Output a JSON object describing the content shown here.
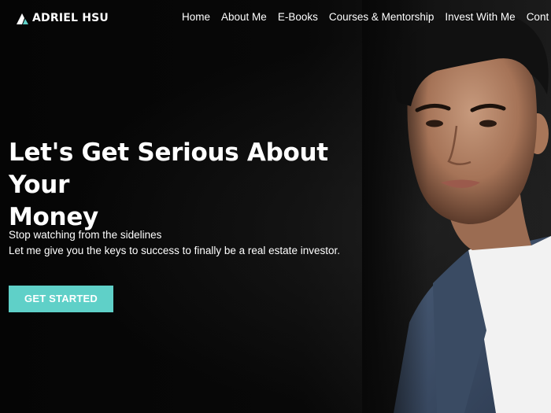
{
  "brand": {
    "name": "ADRIEL HSU",
    "logo_icon": "mountain-logo-icon",
    "accent_color": "#5fd0c8"
  },
  "nav": {
    "items": [
      {
        "label": "Home"
      },
      {
        "label": "About Me"
      },
      {
        "label": "E-Books"
      },
      {
        "label": "Courses & Mentorship"
      },
      {
        "label": "Invest With Me"
      },
      {
        "label": "Cont"
      }
    ]
  },
  "hero": {
    "title_line1": "Let's Get Serious About Your",
    "title_line2": "Money",
    "subtitle_line1": "Stop watching from the sidelines",
    "subtitle_line2": "Let me give you the keys to success to finally be a real estate investor.",
    "cta_label": "GET STARTED"
  }
}
